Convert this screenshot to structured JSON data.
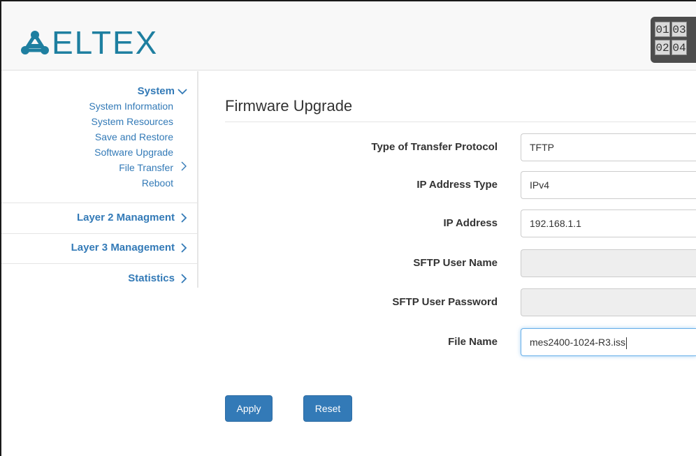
{
  "brand": {
    "logo_text": "ELTEX",
    "color": "#1e7fa0"
  },
  "ports": [
    "01",
    "03",
    "02",
    "04"
  ],
  "sidebar": {
    "system": {
      "label": "System",
      "items": [
        {
          "label": "System Information"
        },
        {
          "label": "System Resources"
        },
        {
          "label": "Save and Restore"
        },
        {
          "label": "Software Upgrade"
        },
        {
          "label": "File Transfer"
        },
        {
          "label": "Reboot"
        }
      ]
    },
    "layer2": "Layer 2 Managment",
    "layer3": "Layer 3 Management",
    "statistics": "Statistics"
  },
  "main": {
    "title": "Firmware Upgrade",
    "fields": [
      {
        "label": "Type of Transfer Protocol",
        "value": "TFTP"
      },
      {
        "label": "IP Address Type",
        "value": "IPv4"
      },
      {
        "label": "IP Address",
        "value": "192.168.1.1"
      },
      {
        "label": "SFTP User Name",
        "value": ""
      },
      {
        "label": "SFTP User Password",
        "value": ""
      },
      {
        "label": "File Name",
        "value": "mes2400-1024-R3.iss"
      }
    ],
    "apply_label": "Apply",
    "reset_label": "Reset"
  },
  "colors": {
    "link": "#337ab7",
    "button": "#337ab7"
  }
}
